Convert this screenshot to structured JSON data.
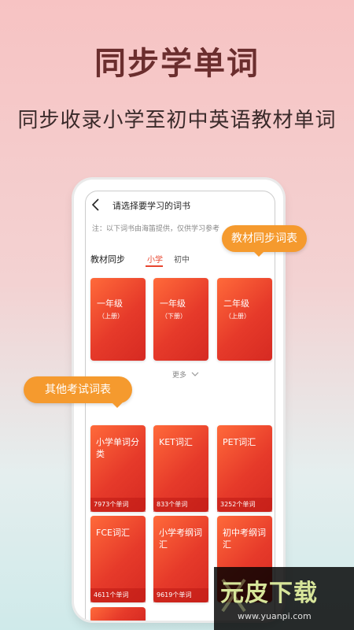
{
  "promo": {
    "headline": "同步学单词",
    "subheadline": "同步收录小学至初中英语教材单词"
  },
  "app": {
    "title": "请选择要学习的词书",
    "note": "注：以下词书由海笛提供，仅供学习参考",
    "tabs": {
      "label": "教材同步",
      "items": [
        {
          "label": "小学",
          "active": true
        },
        {
          "label": "初中",
          "active": false
        }
      ]
    },
    "textbooks": [
      {
        "title": "一年级",
        "sub": "（上册）"
      },
      {
        "title": "一年级",
        "sub": "（下册）"
      },
      {
        "title": "二年级",
        "sub": "（上册）"
      }
    ],
    "more_label": "更多",
    "other_books": [
      {
        "name": "小学单词分类",
        "count": "7973个单词"
      },
      {
        "name": "KET词汇",
        "count": "833个单词"
      },
      {
        "name": "PET词汇",
        "count": "3252个单词"
      },
      {
        "name": "FCE词汇",
        "count": "4611个单词"
      },
      {
        "name": "小学考纲词汇",
        "count": "9619个单词"
      },
      {
        "name": "初中考纲词汇",
        "count": ""
      }
    ]
  },
  "callouts": {
    "textbook": "教材同步词表",
    "other": "其他考试词表"
  },
  "watermark": {
    "logo": "元皮下载",
    "url": "www.yuanpi.com"
  },
  "colors": {
    "accent": "#e8452f",
    "callout": "#f59a2e",
    "headline": "#6b2e2e"
  }
}
